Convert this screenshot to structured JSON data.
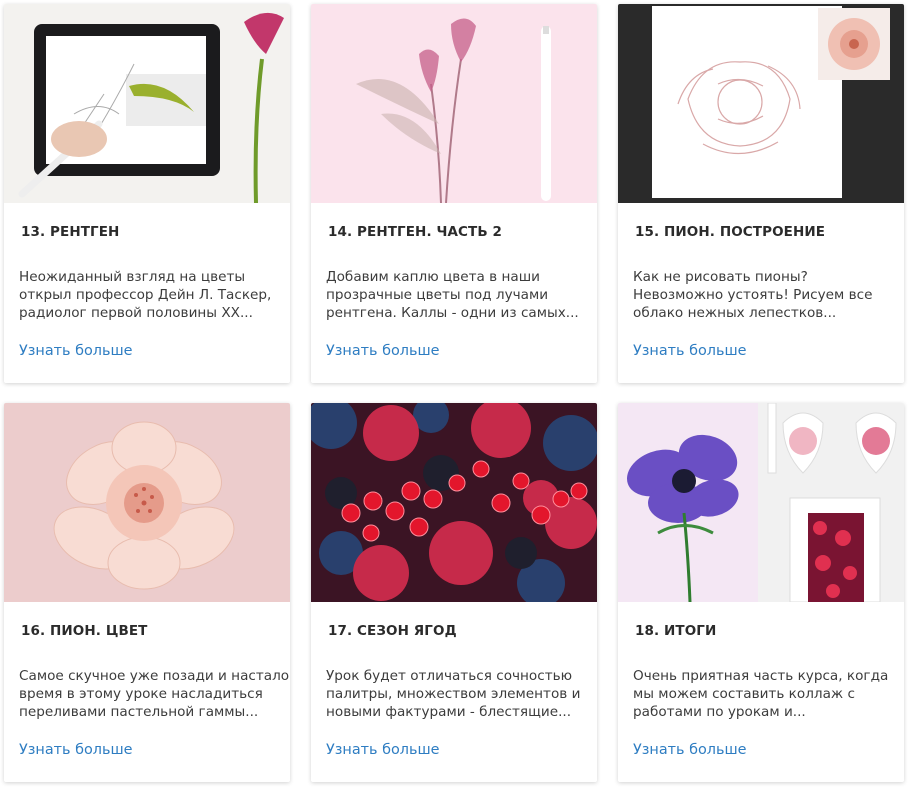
{
  "cards": [
    {
      "title": "13. РЕНТГЕН",
      "desc_lines": [
        "Неожиданный взгляд на цветы",
        "открыл профессор Дейн Л. Таскер,",
        "радиолог первой половины XX..."
      ],
      "link": "Узнать больше",
      "image": "tablet-drawing-calla-lily"
    },
    {
      "title": "14. РЕНТГЕН. ЧАСТЬ 2",
      "desc_lines": [
        "Добавим каплю цвета в наши",
        "прозрачные цветы под лучами",
        "рентгена. Каллы - одни из самых..."
      ],
      "link": "Узнать больше",
      "image": "xray-calla-lilies-with-pencil"
    },
    {
      "title": "15. ПИОН. ПОСТРОЕНИЕ",
      "desc_lines": [
        "Как не рисовать пионы?",
        "Невозможно устоять! Рисуем все",
        "облако нежных лепестков..."
      ],
      "link": "Узнать больше",
      "image": "peony-sketch-with-reference"
    },
    {
      "title": "16. ПИОН. ЦВЕТ",
      "desc_lines": [
        "Самое скучное уже позади и настало",
        "время в этому уроке насладиться",
        "переливами пастельной гаммы..."
      ],
      "link": "Узнать больше",
      "image": "pastel-peony-painting"
    },
    {
      "title": "17. СЕЗОН ЯГОД",
      "desc_lines": [
        "Урок будет отличаться сочностью",
        "палитры, множеством элементов и",
        "новыми фактурами - блестящие..."
      ],
      "link": "Узнать больше",
      "image": "berries-painting"
    },
    {
      "title": "18. ИТОГИ",
      "desc_lines": [
        "Очень приятная часть курса, когда",
        "мы можем составить коллаж с",
        "работами по урокам и..."
      ],
      "link": "Узнать больше",
      "image": "anemone-collage-with-frames"
    }
  ],
  "colors": {
    "link": "#2e7dc2",
    "title": "#2b2b2b",
    "text": "#3c3c3c"
  }
}
